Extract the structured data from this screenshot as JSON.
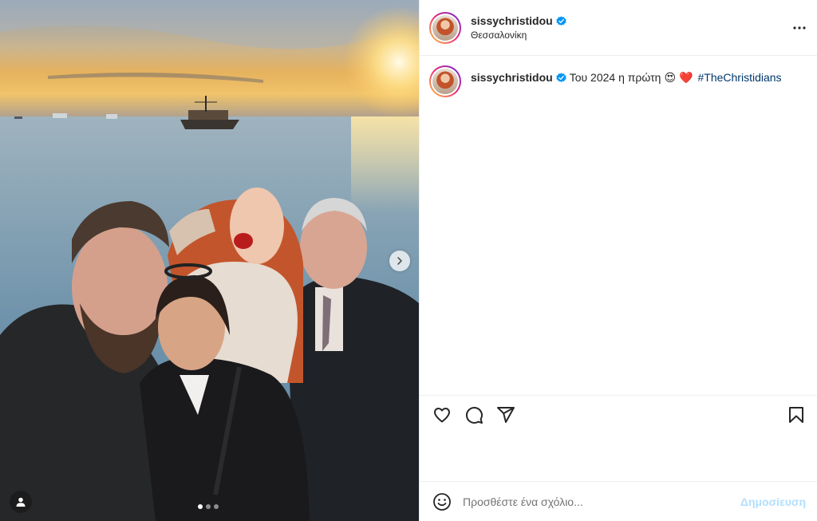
{
  "post": {
    "username": "sissychristidou",
    "verified": true,
    "location": "Θεσσαλονίκη",
    "caption": {
      "text": "Του 2024 η πρώτη",
      "emojis": [
        "😍",
        "❤️"
      ],
      "hashtag": "#TheChristidians"
    },
    "carousel": {
      "total": 3,
      "current": 1
    }
  },
  "icons": {
    "more": "more-options-icon",
    "verified": "verified-badge-icon",
    "like": "heart-icon",
    "comment": "comment-icon",
    "share": "share-icon",
    "save": "bookmark-icon",
    "emoji": "emoji-icon",
    "tag": "user-tag-icon",
    "next": "chevron-right-icon"
  },
  "comment_box": {
    "placeholder": "Προσθέστε ένα σχόλιο...",
    "post_label": "Δημοσίευση"
  },
  "colors": {
    "verified_blue": "#0095f6",
    "hashtag": "#00376b",
    "post_disabled": "#b2dffc"
  }
}
